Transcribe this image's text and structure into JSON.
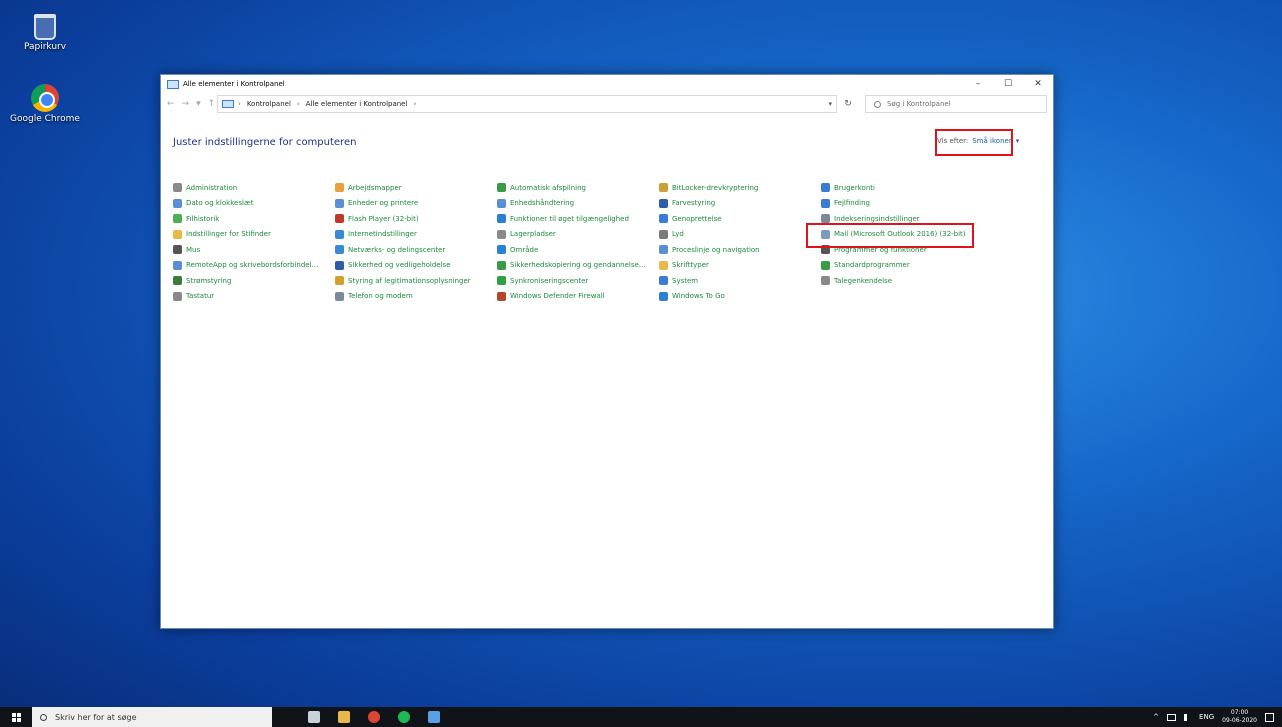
{
  "desktop": {
    "icons": [
      {
        "label": "Papirkurv"
      },
      {
        "label": "Google Chrome"
      }
    ]
  },
  "window": {
    "title": "Alle elementer i Kontrolpanel",
    "controls": {
      "minimize": "–",
      "maximize": "☐",
      "close": "✕"
    },
    "nav": {
      "back": "←",
      "forward": "→",
      "recent": "▾",
      "up": "↑"
    },
    "breadcrumb": [
      "Kontrolpanel",
      "Alle elementer i Kontrolpanel"
    ],
    "breadcrumb_sep": "›",
    "refresh": "↻",
    "search_placeholder": "Søg i Kontrolpanel",
    "header": "Juster indstillingerne for computeren",
    "view_label": "Vis efter:",
    "view_value": "Små ikoner",
    "view_chevron": "▾",
    "items": [
      {
        "label": "Administration",
        "icon": "admin-tools-icon",
        "color": "#8a8a8a"
      },
      {
        "label": "Dato og klokkeslæt",
        "icon": "clock-icon",
        "color": "#5a8fd6"
      },
      {
        "label": "Filhistorik",
        "icon": "file-history-icon",
        "color": "#4caf50"
      },
      {
        "label": "Indstillinger for Stifinder",
        "icon": "folder-options-icon",
        "color": "#e8b84a"
      },
      {
        "label": "Mus",
        "icon": "mouse-icon",
        "color": "#555555"
      },
      {
        "label": "RemoteApp og skrivebordsforbindel...",
        "icon": "remote-app-icon",
        "color": "#5a8fd6"
      },
      {
        "label": "Strømstyring",
        "icon": "power-icon",
        "color": "#3d7a3d"
      },
      {
        "label": "Tastatur",
        "icon": "keyboard-icon",
        "color": "#888888"
      },
      {
        "label": "Arbejdsmapper",
        "icon": "work-folders-icon",
        "color": "#e8a23a"
      },
      {
        "label": "Enheder og printere",
        "icon": "printer-icon",
        "color": "#5a8fd6"
      },
      {
        "label": "Flash Player (32-bit)",
        "icon": "flash-icon",
        "color": "#c0392b"
      },
      {
        "label": "Internetindstillinger",
        "icon": "internet-options-icon",
        "color": "#3a8ad6"
      },
      {
        "label": "Netværks- og delingscenter",
        "icon": "network-icon",
        "color": "#3a8ad6"
      },
      {
        "label": "Sikkerhed og vedligeholdelse",
        "icon": "flag-icon",
        "color": "#2c5fa8"
      },
      {
        "label": "Styring af legitimationsoplysninger",
        "icon": "credential-icon",
        "color": "#d4a02c"
      },
      {
        "label": "Telefon og modem",
        "icon": "phone-icon",
        "color": "#7a8a9a"
      },
      {
        "label": "Automatisk afspilning",
        "icon": "autoplay-icon",
        "color": "#3a9a4a"
      },
      {
        "label": "Enhedshåndtering",
        "icon": "device-manager-icon",
        "color": "#5a8fd6"
      },
      {
        "label": "Funktioner til øget tilgængelighed",
        "icon": "accessibility-icon",
        "color": "#2c7fd6"
      },
      {
        "label": "Lagerpladser",
        "icon": "storage-icon",
        "color": "#8a8a8a"
      },
      {
        "label": "Område",
        "icon": "region-icon",
        "color": "#2c7fd6"
      },
      {
        "label": "Sikkerhedskopiering og gendannelse...",
        "icon": "backup-icon",
        "color": "#3a9a4a"
      },
      {
        "label": "Synkroniseringscenter",
        "icon": "sync-icon",
        "color": "#2ea043"
      },
      {
        "label": "Windows Defender Firewall",
        "icon": "firewall-icon",
        "color": "#b5452c"
      },
      {
        "label": "BitLocker-drevkryptering",
        "icon": "bitlocker-icon",
        "color": "#c9a13a"
      },
      {
        "label": "Farvestyring",
        "icon": "color-management-icon",
        "color": "#2c5fa8"
      },
      {
        "label": "Genoprettelse",
        "icon": "recovery-icon",
        "color": "#3a7bd5"
      },
      {
        "label": "Lyd",
        "icon": "speaker-icon",
        "color": "#7a7a7a"
      },
      {
        "label": "Proceslinje og navigation",
        "icon": "taskbar-icon",
        "color": "#5a8fd6"
      },
      {
        "label": "Skrifttyper",
        "icon": "fonts-icon",
        "color": "#e8b84a"
      },
      {
        "label": "System",
        "icon": "system-icon",
        "color": "#3a7bd5"
      },
      {
        "label": "Windows To Go",
        "icon": "windows-to-go-icon",
        "color": "#2c7fd6"
      },
      {
        "label": "Brugerkonti",
        "icon": "user-accounts-icon",
        "color": "#3a7bd5"
      },
      {
        "label": "Fejlfinding",
        "icon": "troubleshooting-icon",
        "color": "#3a7bd5"
      },
      {
        "label": "Indekseringsindstillinger",
        "icon": "indexing-icon",
        "color": "#7a8a9a"
      },
      {
        "label": "Mail (Microsoft Outlook 2016) (32-bit)",
        "icon": "mail-icon",
        "color": "#7a9ac0"
      },
      {
        "label": "Programmer og funktioner",
        "icon": "programs-icon",
        "color": "#555555"
      },
      {
        "label": "Standardprogrammer",
        "icon": "default-programs-icon",
        "color": "#3a9a4a"
      },
      {
        "label": "Talegenkendelse",
        "icon": "microphone-icon",
        "color": "#888888"
      }
    ]
  },
  "taskbar": {
    "search_placeholder": "Skriv her for at søge",
    "apps": [
      {
        "name": "task-view-icon",
        "color": "#c8d0da"
      },
      {
        "name": "file-explorer-icon",
        "color": "#e8b84a"
      },
      {
        "name": "chrome-icon",
        "color": "#db4437"
      },
      {
        "name": "spotify-icon",
        "color": "#1db954"
      },
      {
        "name": "control-panel-icon",
        "color": "#5aa0e6"
      }
    ],
    "tray": {
      "chevron": "^",
      "language": "ENG",
      "time": "07:00",
      "date": "09-06-2020"
    }
  },
  "colors": {
    "highlight": "#e0121b",
    "link": "#1e8a3c",
    "header": "#1e3287"
  }
}
